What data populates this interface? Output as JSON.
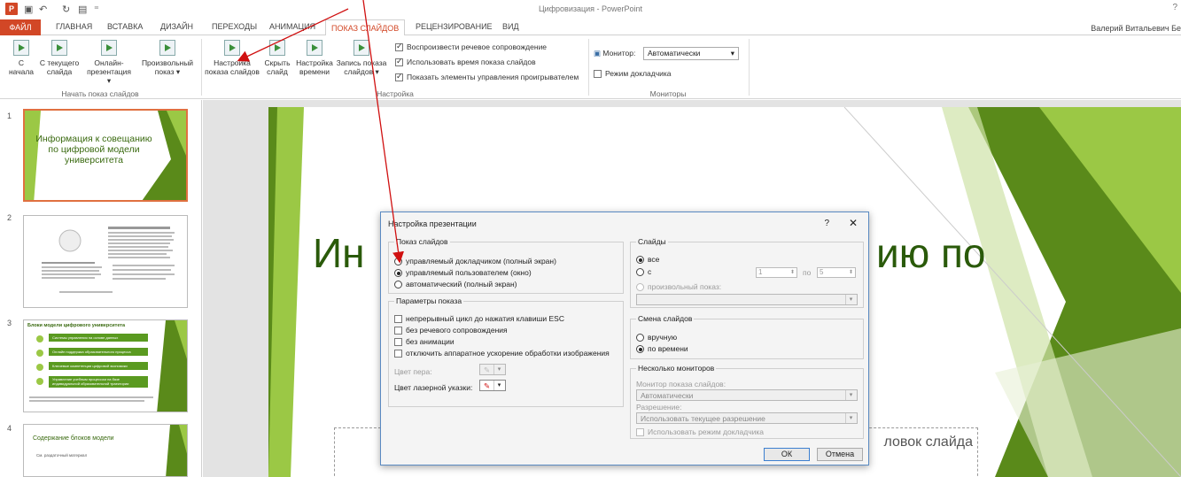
{
  "window": {
    "title": "Цифровизация - PowerPoint",
    "user": "Валерий Витальевич Бе",
    "controls": "?"
  },
  "tabs": [
    "ФАЙЛ",
    "ГЛАВНАЯ",
    "ВСТАВКА",
    "ДИЗАЙН",
    "ПЕРЕХОДЫ",
    "АНИМАЦИЯ",
    "ПОКАЗ СЛАЙДОВ",
    "РЕЦЕНЗИРОВАНИЕ",
    "ВИД"
  ],
  "ribbon": {
    "start_group": {
      "label": "Начать показ слайдов",
      "buttons": [
        {
          "l1": "С",
          "l2": "начала"
        },
        {
          "l1": "С текущего",
          "l2": "слайда"
        },
        {
          "l1": "Онлайн-",
          "l2": "презентация ▾"
        },
        {
          "l1": "Произвольный",
          "l2": "показ ▾"
        }
      ]
    },
    "setup_group": {
      "label": "Настройка",
      "buttons": [
        {
          "l1": "Настройка",
          "l2": "показа слайдов"
        },
        {
          "l1": "Скрыть",
          "l2": "слайд"
        },
        {
          "l1": "Настройка",
          "l2": "времени"
        },
        {
          "l1": "Запись показа",
          "l2": "слайдов ▾"
        }
      ],
      "checks": [
        "Воспроизвести речевое сопровождение",
        "Использовать время показа слайдов",
        "Показать элементы управления проигрывателем"
      ]
    },
    "monitors_group": {
      "label": "Мониторы",
      "monitor_label": "Монитор:",
      "monitor_value": "Автоматически",
      "presenter_view": "Режим докладчика"
    }
  },
  "thumbnails": [
    {
      "num": "1",
      "title": "Информация к совещанию по цифровой модели университета"
    },
    {
      "num": "2"
    },
    {
      "num": "3",
      "title": "Блоки модели цифрового университета",
      "rows": [
        "Системы управления на основе данных",
        "Онлайн поддержка образовательного процесса",
        "Ключевые компетенции цифровой экономики",
        "Управление учебным процессом на базе индивидуальной образовательной траектории"
      ]
    },
    {
      "num": "4",
      "title": "Содержание блоков модели",
      "sub": "См. раздаточный материал"
    }
  ],
  "slide": {
    "title_left": "Ин",
    "title_right": "ию по",
    "subtitle_placeholder": "ловок слайда"
  },
  "dialog": {
    "title": "Настройка презентации",
    "help": "?",
    "close": "✕",
    "show_type": {
      "legend": "Показ слайдов",
      "options": [
        "управляемый докладчиком (полный экран)",
        "управляемый пользователем (окно)",
        "автоматический (полный экран)"
      ]
    },
    "show_options": {
      "legend": "Параметры показа",
      "options": [
        "непрерывный цикл до нажатия клавиши ESC",
        "без речевого сопровождения",
        "без анимации",
        "отключить аппаратное ускорение обработки изображения"
      ],
      "pen_color": "Цвет пера:",
      "laser_color": "Цвет лазерной указки:"
    },
    "slides": {
      "legend": "Слайды",
      "all": "все",
      "from": "с",
      "from_value": "1",
      "to_label": "по",
      "to_value": "5",
      "custom": "произвольный показ:"
    },
    "advance": {
      "legend": "Смена слайдов",
      "manual": "вручную",
      "timings": "по времени"
    },
    "monitors": {
      "legend": "Несколько мониторов",
      "monitor_label": "Монитор показа слайдов:",
      "monitor_value": "Автоматически",
      "resolution_label": "Разрешение:",
      "resolution_value": "Использовать текущее разрешение",
      "presenter_view": "Использовать режим докладчика"
    },
    "ok": "ОК",
    "cancel": "Отмена"
  },
  "colors": {
    "accent": "#d24726",
    "green_dark": "#5a8a1a",
    "green_light": "#9bc845",
    "arrow": "#d01010"
  }
}
